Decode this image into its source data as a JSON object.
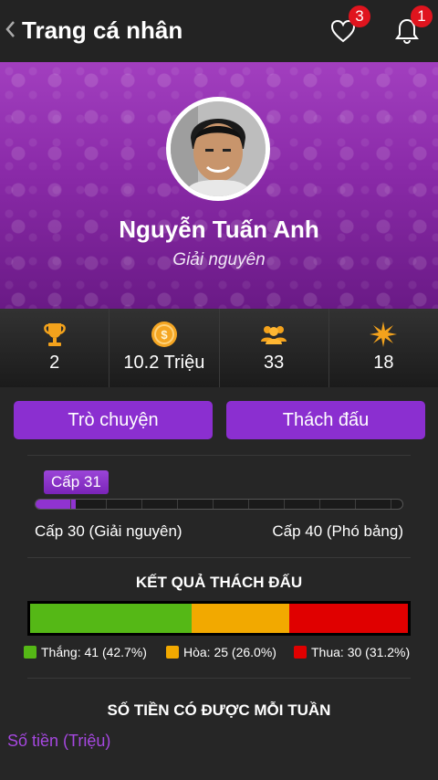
{
  "header": {
    "back_icon": "chevron-left-icon",
    "title": "Trang cá nhân",
    "favorites_badge": "3",
    "notifications_badge": "1"
  },
  "profile": {
    "name": "Nguyễn Tuấn Anh",
    "rank": "Giải nguyên"
  },
  "stats": [
    {
      "icon": "trophy-icon",
      "value": "2"
    },
    {
      "icon": "coin-icon",
      "value": "10.2 Triệu"
    },
    {
      "icon": "friends-icon",
      "value": "33"
    },
    {
      "icon": "star-icon",
      "value": "18"
    }
  ],
  "actions": {
    "chat_label": "Trò chuyện",
    "challenge_label": "Thách đấu"
  },
  "level": {
    "current": "Cấp 31",
    "progress": 0.11,
    "from_label": "Cấp 30 (Giải nguyên)",
    "to_label": "Cấp 40 (Phó bảng)"
  },
  "results": {
    "title": "KẾT QUẢ THÁCH ĐẤU",
    "segments": [
      {
        "label": "Thắng: 41 (42.7%)",
        "percent": 42.7,
        "color": "#55b816"
      },
      {
        "label": "Hòa: 25 (26.0%)",
        "percent": 26.0,
        "color": "#f2a900"
      },
      {
        "label": "Thua: 30 (31.2%)",
        "percent": 31.2,
        "color": "#e00000"
      }
    ]
  },
  "weekly_money": {
    "title": "SỐ TIỀN CÓ ĐƯỢC MỖI TUẦN",
    "axis_label": "Số tiền (Triệu)"
  },
  "colors": {
    "accent": "#8b2fd0",
    "hero": "#8a2aa8"
  }
}
